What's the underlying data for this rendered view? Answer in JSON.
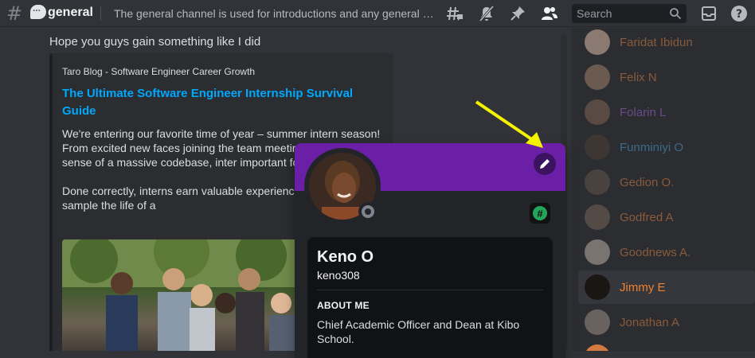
{
  "header": {
    "channel_name": "general",
    "topic": "The general channel is used for introductions and any general disc...",
    "search_placeholder": "Search"
  },
  "message": {
    "text": "Hope you guys gain something like I did",
    "embed": {
      "provider": "Taro Blog - Software Engineer Career Growth",
      "title": "The Ultimate Software Engineer Internship Survival Guide",
      "desc_p1": "We're entering our favorite time of year – summer intern season! From excited new faces joining the team meeting trying to make sense of a massive codebase, inter important for students.",
      "desc_p2": "Done correctly, interns earn valuable experience, careers, and sample the life of a"
    }
  },
  "members": [
    {
      "name": "Faridat Ibidun",
      "color": "#8a5a3a"
    },
    {
      "name": "Felix N",
      "color": "#8a5a3a"
    },
    {
      "name": "Folarin L",
      "color": "#6a4a8a"
    },
    {
      "name": "Funminiyi O",
      "color": "#3a6a8a"
    },
    {
      "name": "Gedion O.",
      "color": "#8a5a3a"
    },
    {
      "name": "Godfred A",
      "color": "#8a5a3a"
    },
    {
      "name": "Goodnews A.",
      "color": "#8a5a3a"
    },
    {
      "name": "Jimmy E",
      "color": "#f0812a"
    },
    {
      "name": "Jonathan A",
      "color": "#8a5a3a"
    }
  ],
  "profile": {
    "display_name": "Keno O",
    "username": "keno308",
    "about_heading": "ABOUT ME",
    "about": "Chief Academic Officer and Dean at Kibo School.",
    "badge_glyph": "#",
    "banner_color": "#6a1fa6"
  }
}
